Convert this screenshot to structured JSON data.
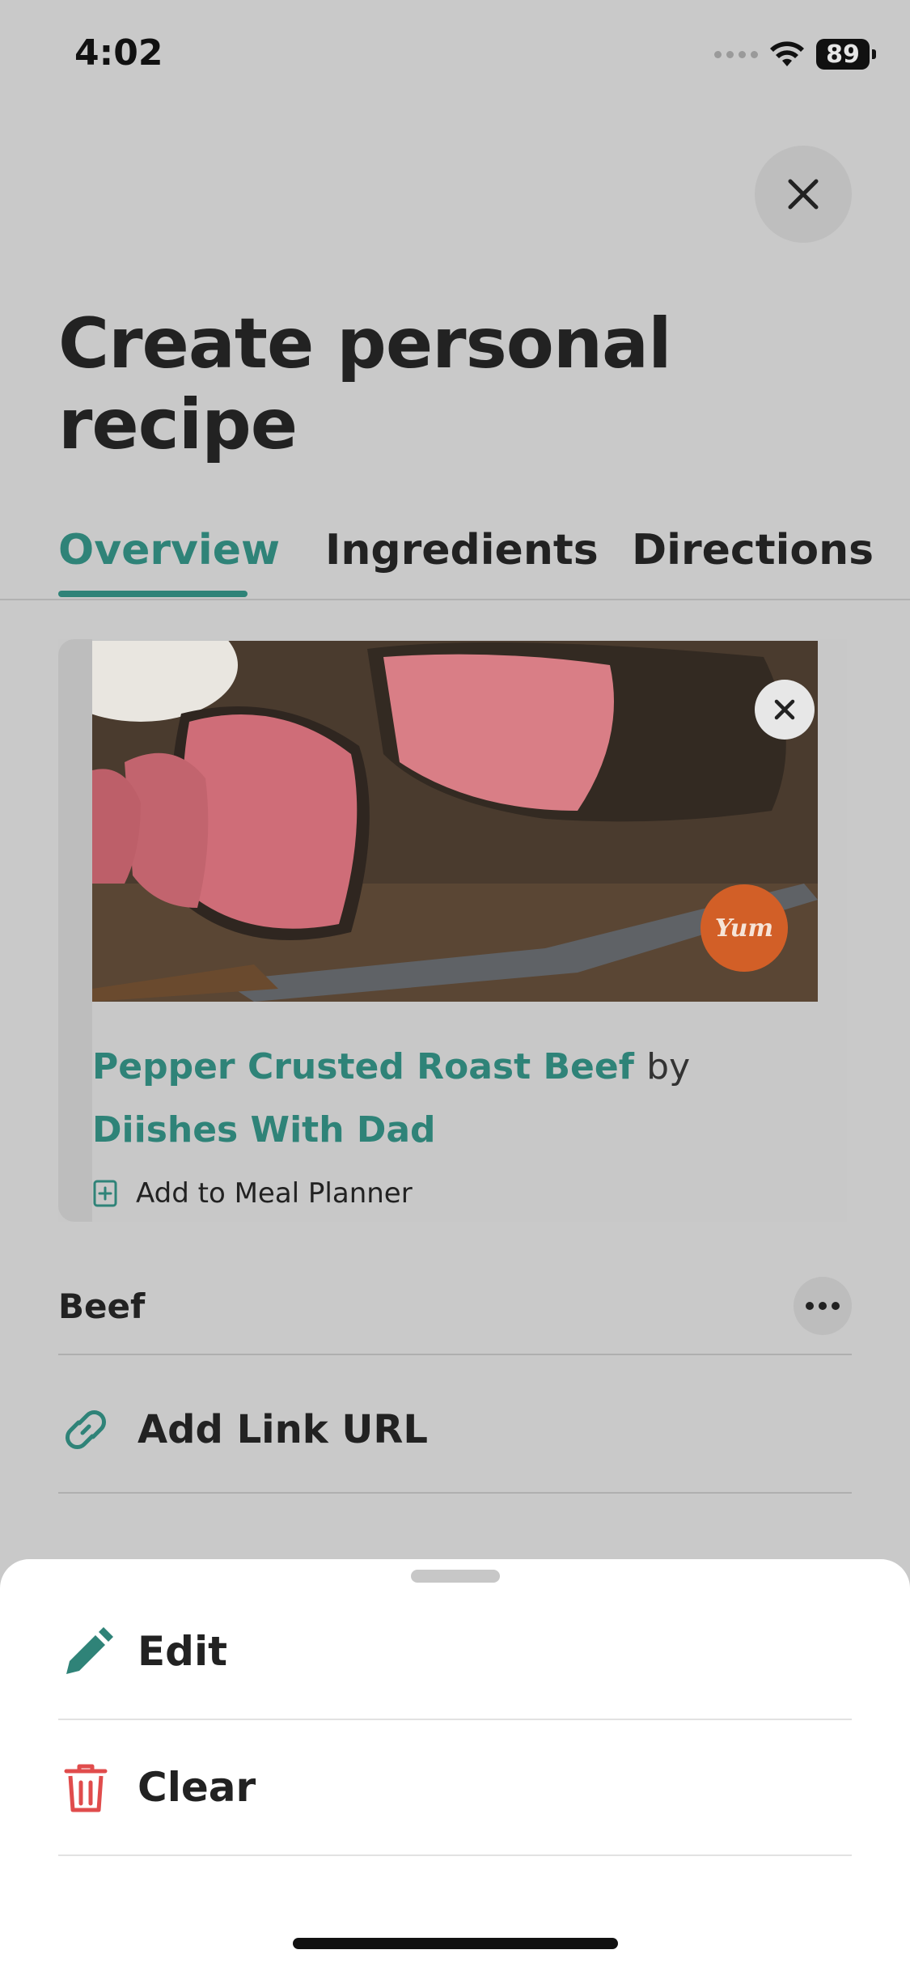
{
  "status_bar": {
    "time": "4:02",
    "battery": "89"
  },
  "header": {
    "title": "Create personal recipe",
    "close_icon": "close-icon"
  },
  "tabs": [
    {
      "label": "Overview",
      "active": true
    },
    {
      "label": "Ingredients",
      "active": false
    },
    {
      "label": "Directions",
      "active": false
    }
  ],
  "recipe_card": {
    "title": "Pepper Crusted Roast Beef",
    "by": "by",
    "author": "Diishes With Dad",
    "meal_planner_label": "Add to Meal Planner",
    "badge_text": "Yum"
  },
  "category": {
    "label": "Beef"
  },
  "link": {
    "label": "Add Link URL"
  },
  "action_sheet": {
    "items": [
      {
        "label": "Edit",
        "icon": "pencil-icon",
        "color": "#2f8378"
      },
      {
        "label": "Clear",
        "icon": "trash-icon",
        "color": "#e04c4c"
      }
    ]
  },
  "colors": {
    "accent": "#2f8378",
    "danger": "#e04c4c",
    "badge": "#d25f27"
  }
}
